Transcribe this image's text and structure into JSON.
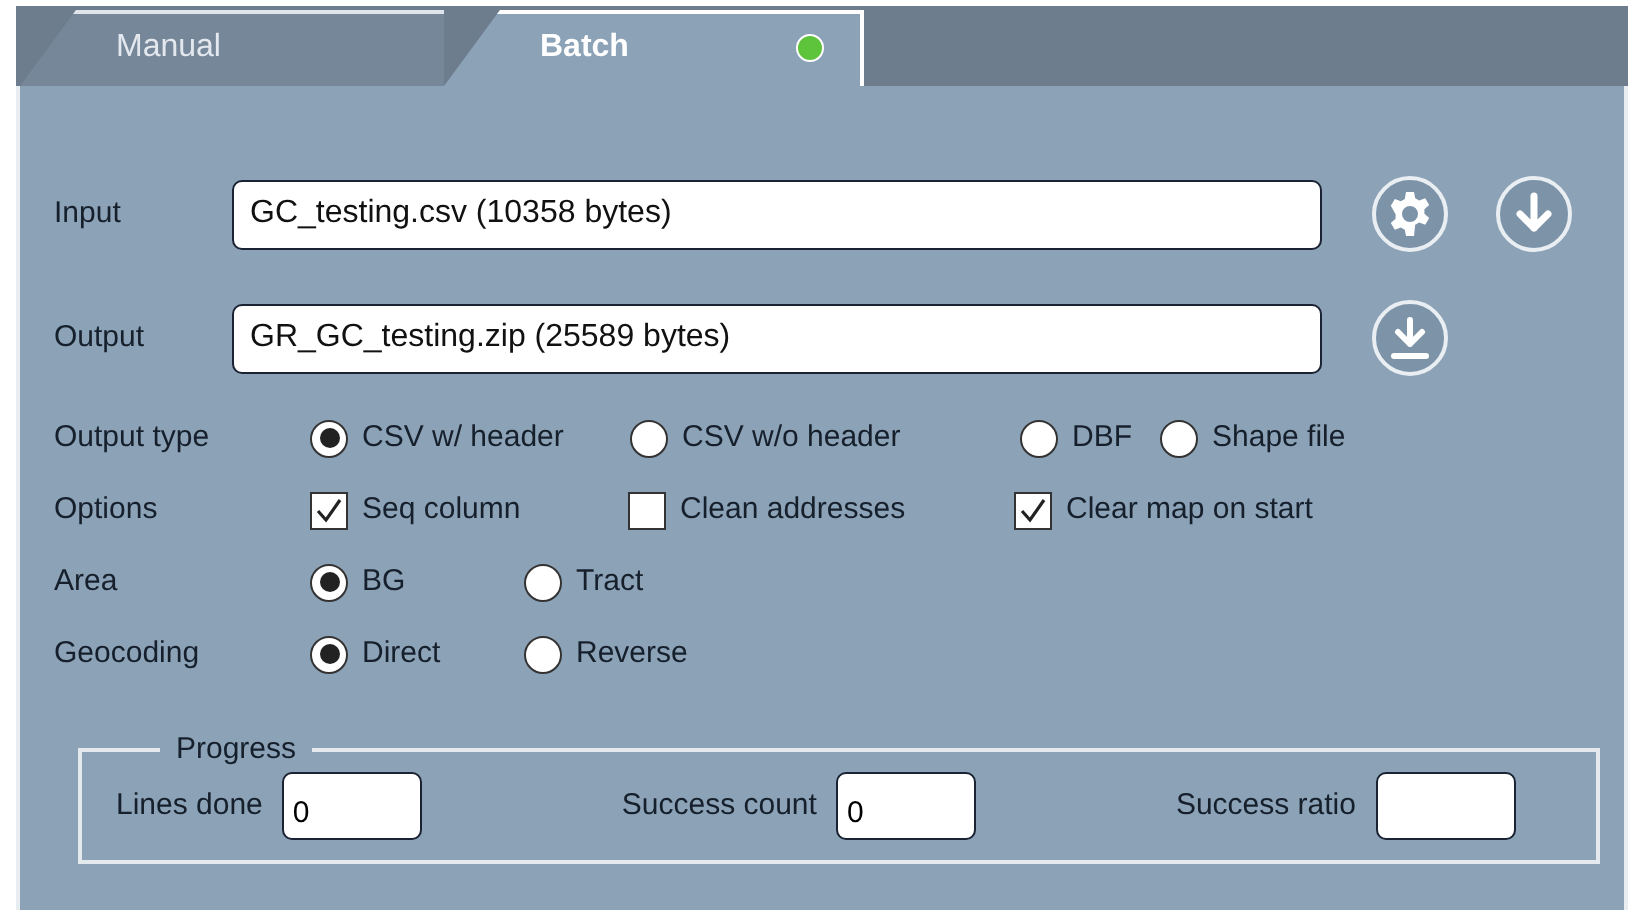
{
  "tabs": [
    {
      "label": "Manual",
      "selected": false,
      "status_on": false
    },
    {
      "label": "Batch",
      "selected": true,
      "status_on": true
    }
  ],
  "files": [
    {
      "label": "Input",
      "value": "GC_testing.csv (10358 bytes)",
      "buttons": [
        {
          "kind": "settings"
        },
        {
          "kind": "down"
        }
      ]
    },
    {
      "label": "Output",
      "value": "GR_GC_testing.zip (25589 bytes)",
      "buttons": [
        {
          "kind": "download"
        }
      ]
    }
  ],
  "option_groups": [
    {
      "label": "Output type",
      "kind": "radio",
      "options": [
        {
          "label": "CSV w/ header",
          "selected": true
        },
        {
          "label": "CSV w/o header",
          "selected": false
        },
        {
          "label": "DBF",
          "selected": false
        },
        {
          "label": "Shape file",
          "selected": false
        }
      ]
    },
    {
      "label": "Options",
      "kind": "checkbox",
      "options": [
        {
          "label": "Seq column",
          "checked": true
        },
        {
          "label": "Clean addresses",
          "checked": false
        },
        {
          "label": "Clear map on start",
          "checked": true
        }
      ]
    },
    {
      "label": "Area",
      "kind": "radio",
      "options": [
        {
          "label": "BG",
          "selected": true
        },
        {
          "label": "Tract",
          "selected": false
        }
      ]
    },
    {
      "label": "Geocoding",
      "kind": "radio",
      "options": [
        {
          "label": "Direct",
          "selected": true
        },
        {
          "label": "Reverse",
          "selected": false
        }
      ]
    }
  ],
  "progress": {
    "title": "Progress",
    "fields": [
      {
        "label": "Lines done",
        "value": "0"
      },
      {
        "label": "Success count",
        "value": "0"
      },
      {
        "label": "Success ratio"
      }
    ]
  }
}
